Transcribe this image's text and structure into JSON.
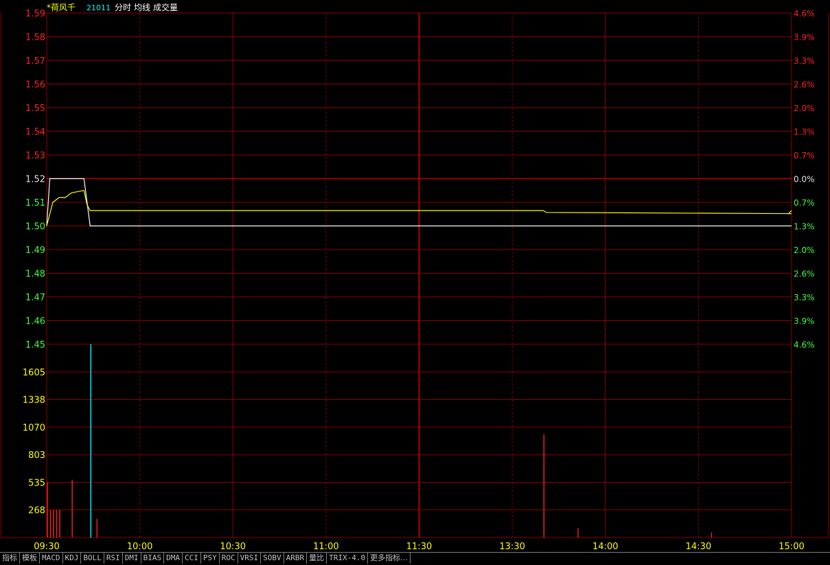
{
  "header": {
    "stock_name": "*荷风千",
    "code": "21011",
    "labels": [
      "分时",
      "均线",
      "成交量"
    ]
  },
  "colors": {
    "grid": "#8b0000",
    "up": "#ff2020",
    "down": "#40ff40",
    "vol_label": "#ffff00",
    "price_line": "#ffffff",
    "avg_line": "#ffff00",
    "time_label": "#ffff00"
  },
  "chart_data": {
    "type": "line",
    "price_axis": {
      "ticks": [
        "1.59",
        "1.58",
        "1.57",
        "1.56",
        "1.55",
        "1.54",
        "1.53",
        "1.52",
        "1.51",
        "1.50",
        "1.49",
        "1.48",
        "1.47",
        "1.46",
        "1.45"
      ],
      "ylim": [
        1.45,
        1.59
      ],
      "prev_close": 1.52
    },
    "pct_axis": {
      "ticks": [
        "4.6%",
        "3.9%",
        "3.3%",
        "2.6%",
        "2.0%",
        "1.3%",
        "0.7%",
        "0.0%",
        "0.7%",
        "1.3%",
        "2.0%",
        "2.6%",
        "3.3%",
        "3.9%",
        "4.6%"
      ]
    },
    "volume_axis": {
      "ticks": [
        "1605",
        "1338",
        "1070",
        "803",
        "535",
        "268"
      ],
      "ylim": [
        0,
        1873
      ]
    },
    "x_labels": [
      "09:30",
      "10:00",
      "10:30",
      "11:00",
      "11:30",
      "13:30",
      "14:00",
      "14:30",
      "15:00"
    ],
    "series": [
      {
        "key": "price",
        "points": [
          [
            0,
            1.5
          ],
          [
            0.5,
            1.51
          ],
          [
            1,
            1.52
          ],
          [
            12,
            1.52
          ],
          [
            13,
            1.51
          ],
          [
            14,
            1.5
          ],
          [
            240,
            1.5
          ]
        ]
      },
      {
        "key": "avg",
        "points": [
          [
            0,
            1.5
          ],
          [
            2,
            1.51
          ],
          [
            4,
            1.512
          ],
          [
            6,
            1.512
          ],
          [
            8,
            1.514
          ],
          [
            12,
            1.515
          ],
          [
            13,
            1.509
          ],
          [
            14,
            1.5065
          ],
          [
            80,
            1.5065
          ],
          [
            160,
            1.5065
          ],
          [
            161,
            1.5057
          ],
          [
            240,
            1.5052
          ],
          [
            239,
            1.5052
          ],
          [
            240,
            1.5065
          ]
        ]
      }
    ],
    "volume": [
      {
        "t": 0,
        "v": 540,
        "dir": "up"
      },
      {
        "t": 1,
        "v": 268,
        "dir": "up"
      },
      {
        "t": 2,
        "v": 268,
        "dir": "up"
      },
      {
        "t": 3,
        "v": 268,
        "dir": "up"
      },
      {
        "t": 4,
        "v": 268,
        "dir": "up"
      },
      {
        "t": 8,
        "v": 560,
        "dir": "up"
      },
      {
        "t": 14,
        "v": 1873,
        "dir": "flat"
      },
      {
        "t": 16,
        "v": 180,
        "dir": "down"
      },
      {
        "t": 160,
        "v": 1000,
        "dir": "down"
      },
      {
        "t": 171,
        "v": 90,
        "dir": "down"
      },
      {
        "t": 214,
        "v": 50,
        "dir": "down"
      }
    ]
  },
  "tabs": [
    "指标",
    "模板",
    "MACD",
    "KDJ",
    "BOLL",
    "RSI",
    "DMI",
    "BIAS",
    "DMA",
    "CCI",
    "PSY",
    "ROC",
    "VRSI",
    "SOBV",
    "ARBR",
    "量比",
    "TRIX-4.0",
    "更多指标..."
  ]
}
